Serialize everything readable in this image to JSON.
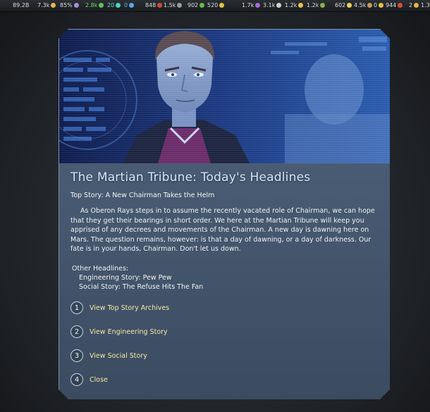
{
  "resources": [
    {
      "value": "89.2B",
      "color": "#c9c9c9"
    },
    {
      "value": "7.3k",
      "color": "#e5b552"
    },
    {
      "value": "85%",
      "color": "#a78bd6"
    },
    {
      "value": "2.8k",
      "color": "#5fc25a"
    },
    {
      "value": "20",
      "color": "#4fd0c0"
    },
    {
      "value": "0",
      "color": "#5aa7e8"
    },
    {
      "value": "848",
      "color": "#d04a3a"
    },
    {
      "value": "1.5k",
      "color": "#9a9a9a"
    },
    {
      "value": "902",
      "color": "#5fbf4a"
    },
    {
      "value": "520",
      "color": "#e0c440"
    },
    {
      "value": "1.7k",
      "color": "#a46ad8"
    },
    {
      "value": "3.1k",
      "color": "#d0d0d0"
    },
    {
      "value": "1.2k",
      "color": "#e6c050"
    },
    {
      "value": "1.2k",
      "color": "#8ab04a"
    },
    {
      "value": "602",
      "color": "#e8d35a"
    },
    {
      "value": "4.5k",
      "color": "#c89a5a"
    },
    {
      "value": "0",
      "color": "#e8c040"
    },
    {
      "value": "944",
      "color": "#d0503a"
    },
    {
      "value": "2",
      "color": "#e0b840"
    },
    {
      "value": "1.3",
      "color": "#c8c8c8"
    }
  ],
  "dialog": {
    "title": "The Martian Tribune:  Today's Headlines",
    "top_story": "Top Story:  A New Chairman Takes the Helm",
    "body": "As Oberon Rays steps in to assume the recently vacated role of Chairman, we can hope that they get their bearings in short order.  We here at the Martian Tribune will keep you apprised of any decrees and movements of the Chairman.  A new day is dawning here on Mars.  The question remains, however: is that a day of dawning, or a day of darkness.  Our fate is in your hands, Chairman.  Don't let us down.",
    "other_heading": "Other Headlines:",
    "other_items": [
      "Engineering Story:  Pew Pew",
      "Social Story:  The Refuse Hits The Fan"
    ],
    "options": [
      {
        "num": "1",
        "label": "View Top Story Archives"
      },
      {
        "num": "2",
        "label": "View Engineering Story"
      },
      {
        "num": "3",
        "label": "View Social Story"
      },
      {
        "num": "4",
        "label": "Close"
      }
    ]
  }
}
